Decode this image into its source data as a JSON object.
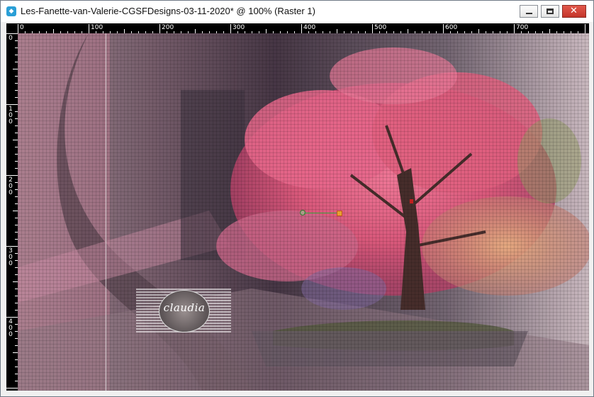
{
  "window": {
    "title": "Les-Fanette-van-Valerie-CGSFDesigns-03-11-2020* @ 100% (Raster 1)",
    "app_icon": "paint-shop-pro-icon",
    "controls": {
      "minimize_icon": "minimize-icon",
      "maximize_icon": "maximize-icon",
      "close_icon": "close-icon",
      "close_glyph": "✕"
    }
  },
  "ruler_top": {
    "labels": [
      "0",
      "100",
      "200",
      "300",
      "400",
      "500",
      "600",
      "700"
    ]
  },
  "ruler_left": {
    "labels": [
      "0",
      "100",
      "200",
      "300",
      "400"
    ]
  },
  "canvas": {
    "watermark_text": "claudia",
    "layer": "Raster 1",
    "zoom": "100%",
    "colors": {
      "tree_pink": "#d8587a",
      "tree_light": "#f08aa4",
      "background_mauve": "#8a6f7c",
      "trunk": "#3a2a24"
    }
  }
}
